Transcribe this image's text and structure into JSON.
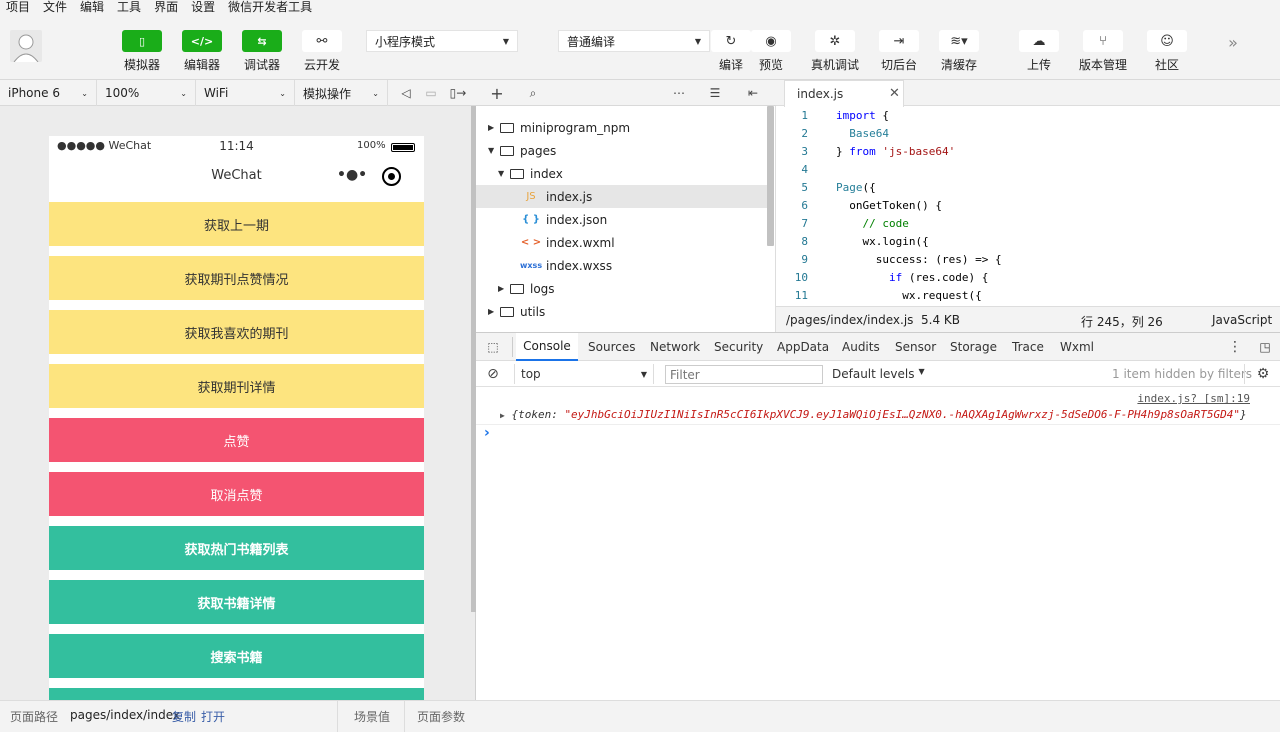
{
  "menu": [
    "项目",
    "文件",
    "编辑",
    "工具",
    "界面",
    "设置",
    "微信开发者工具"
  ],
  "toolbar": {
    "simulator": "模拟器",
    "editor": "编辑器",
    "debugger": "调试器",
    "cloud": "云开发",
    "mode": "小程序模式",
    "compile_mode": "普通编译",
    "compile": "编译",
    "preview": "预览",
    "remote_debug": "真机调试",
    "background": "切后台",
    "clear_cache": "清缓存",
    "upload": "上传",
    "version": "版本管理",
    "community": "社区"
  },
  "device_bar": {
    "device": "iPhone 6",
    "zoom": "100%",
    "network": "WiFi",
    "operation": "模拟操作"
  },
  "phone": {
    "signal": "●●●●● WeChat",
    "time": "11:14",
    "battery": "100%",
    "nav_title": "WeChat",
    "buttons": [
      {
        "label": "获取上一期",
        "style": "yellow"
      },
      {
        "label": "获取期刊点赞情况",
        "style": "yellow"
      },
      {
        "label": "获取我喜欢的期刊",
        "style": "yellow"
      },
      {
        "label": "获取期刊详情",
        "style": "yellow"
      },
      {
        "label": "点赞",
        "style": "red"
      },
      {
        "label": "取消点赞",
        "style": "red"
      },
      {
        "label": "获取热门书籍列表",
        "style": "teal"
      },
      {
        "label": "获取书籍详情",
        "style": "teal"
      },
      {
        "label": "搜索书籍",
        "style": "teal"
      }
    ]
  },
  "tree": [
    {
      "label": "miniprogram_npm",
      "type": "folder",
      "state": "closed"
    },
    {
      "label": "pages",
      "type": "folder",
      "state": "open"
    },
    {
      "label": "index",
      "type": "folder",
      "state": "open"
    },
    {
      "label": "index.js",
      "type": "JS"
    },
    {
      "label": "index.json",
      "type": "{ }"
    },
    {
      "label": "index.wxml",
      "type": "< >"
    },
    {
      "label": "index.wxss",
      "type": "wxss"
    },
    {
      "label": "logs",
      "type": "folder",
      "state": "closed"
    },
    {
      "label": "utils",
      "type": "folder",
      "state": "closed"
    }
  ],
  "editor": {
    "tab": "index.js",
    "lines": [
      "1",
      "2",
      "3",
      "4",
      "5",
      "6",
      "7",
      "8",
      "9",
      "10",
      "11"
    ],
    "path": "/pages/index/index.js",
    "size": "5.4 KB",
    "position": "行 245，列 26",
    "language": "JavaScript"
  },
  "devtools": {
    "tabs": [
      "Console",
      "Sources",
      "Network",
      "Security",
      "AppData",
      "Audits",
      "Sensor",
      "Storage",
      "Trace",
      "Wxml"
    ],
    "context": "top",
    "filter_placeholder": "Filter",
    "levels": "Default levels",
    "hidden": "1 item hidden by filters",
    "source": "index.js? [sm]:19",
    "log_key": "{token: ",
    "log_value": "\"eyJhbGciOiJIUzI1NiIsInR5cCI6IkpXVCJ9.eyJ1aWQiOjEsI…QzNX0.-hAQXAg1AgWwrxzj-5dSeDO6-F-PH4h9p8sOaRT5GD4\"",
    "log_end": "}",
    "prompt": "›"
  },
  "statusbar": {
    "path_label": "页面路径",
    "path": "pages/index/index",
    "copy": "复制",
    "open": "打开",
    "scene": "场景值",
    "params": "页面参数"
  }
}
